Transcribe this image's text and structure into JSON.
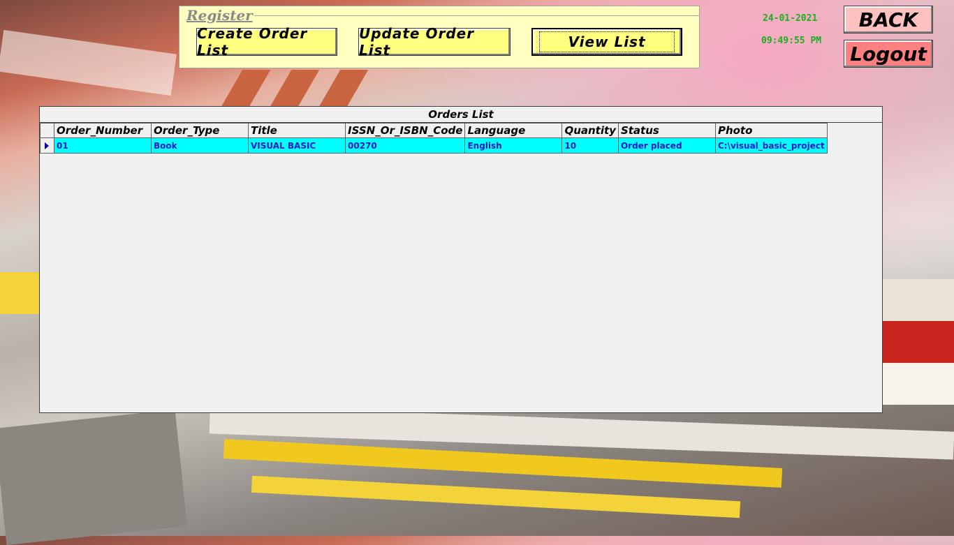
{
  "register": {
    "legend": "Register",
    "create_label": "Create Order List",
    "update_label": "Update Order List",
    "view_label": "View List"
  },
  "clock": {
    "date": "24-01-2021",
    "time": "09:49:55 PM"
  },
  "side": {
    "back_label": "BACK",
    "logout_label": "Logout"
  },
  "grid": {
    "caption": "Orders List",
    "columns": [
      "Order_Number",
      "Order_Type",
      "Title",
      "ISSN_Or_ISBN_Code",
      "Language",
      "Quantity",
      "Status",
      "Photo"
    ],
    "rows": [
      [
        "01",
        "Book",
        "VISUAL BASIC",
        "00270",
        "English",
        "10",
        "Order placed",
        "C:\\visual_basic_project"
      ]
    ]
  },
  "icons": {
    "current_row": "current-row-arrow-icon"
  },
  "colors": {
    "register_bg": "#ffffc0",
    "button_bg": "#ffff80",
    "back_bg": "#ffc0c0",
    "logout_bg": "#ff8080",
    "row_bg": "#00ffff",
    "row_text": "#1818c8",
    "clock": "#1dae1d"
  }
}
